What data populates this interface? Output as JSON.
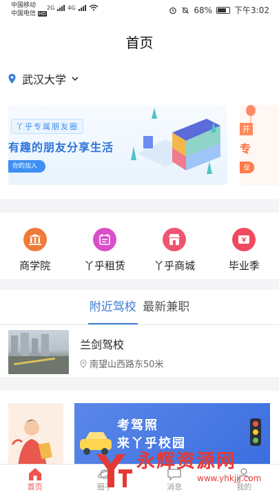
{
  "status_bar": {
    "carrier1": "中国移动",
    "carrier2": "中国电信",
    "hd": "HD",
    "net1": "2G",
    "net2": "4G",
    "battery": "68%",
    "time": "下午3:02"
  },
  "header": {
    "title": "首页"
  },
  "location": {
    "name": "武汉大学"
  },
  "banner": {
    "tag": "丫乎专属朋友圈",
    "headline": "有趣的朋友分享生活",
    "button": "你的加入",
    "next_tag": "开",
    "next_big": "专",
    "next_chip": "促"
  },
  "categories": [
    {
      "label": "商学院",
      "icon": "bank-icon",
      "color": "#f07a3a"
    },
    {
      "label": "丫乎租赁",
      "icon": "calendar-icon",
      "color": "#d94fc9"
    },
    {
      "label": "丫乎商城",
      "icon": "shop-icon",
      "color": "#ef5470"
    },
    {
      "label": "毕业季",
      "icon": "yen-icon",
      "color": "#f04a5f"
    }
  ],
  "tabs": {
    "active": "附近驾校",
    "inactive": "最新兼职"
  },
  "listing": {
    "name": "兰剑驾校",
    "address": "南望山西路东50米"
  },
  "promo": {
    "line1": "考驾照",
    "line2": "来丫乎校园"
  },
  "tabbar": [
    {
      "label": "首页",
      "icon": "home-icon"
    },
    {
      "label": "圈子",
      "icon": "planet-icon"
    },
    {
      "label": "消息",
      "icon": "message-icon"
    },
    {
      "label": "我的",
      "icon": "user-icon"
    }
  ],
  "watermark": {
    "text": "永辉资源网",
    "url": "www.yhkjjj.com"
  },
  "colors": {
    "accent": "#3a7bd5",
    "tab_active": "#ef5350",
    "location_pin": "#3a7bd5"
  }
}
